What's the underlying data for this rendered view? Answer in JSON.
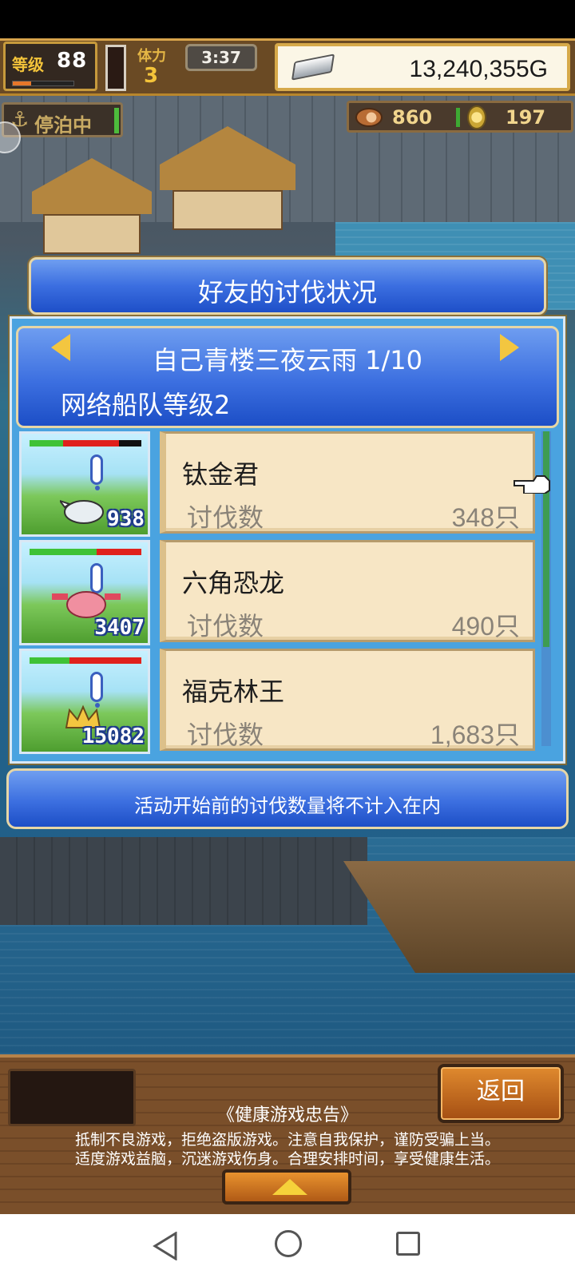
{
  "hud": {
    "level_label": "等级",
    "level_value": "88",
    "exp_fraction": 0.3,
    "stamina_label": "体力",
    "stamina_value": "3",
    "time": "3:37",
    "gold": "13,240,355G",
    "dock_status": "停泊中",
    "food": "860",
    "coins": "197"
  },
  "dialog": {
    "title": "好友的讨伐状况",
    "player_name": "自己青楼三夜云雨 1/10",
    "fleet_level": "网络船队等级2",
    "rows": [
      {
        "monster_kills_badge": "938",
        "friend": "钛金君",
        "kill_label": "讨伐数",
        "kill_count": "348只",
        "hp_green": 0.3,
        "hp_red": 0.5
      },
      {
        "monster_kills_badge": "3407",
        "friend": "六角恐龙",
        "kill_label": "讨伐数",
        "kill_count": "490只",
        "hp_green": 0.6,
        "hp_red": 0.4
      },
      {
        "monster_kills_badge": "15082",
        "friend": "福克林王",
        "kill_label": "讨伐数",
        "kill_count": "1,683只",
        "hp_green": 0.36,
        "hp_red": 0.64
      }
    ],
    "notice": "活动开始前的讨伐数量将不计入在内"
  },
  "bottom": {
    "back_label": "返回",
    "health_title": "《健康游戏忠告》",
    "health_line1": "抵制不良游戏，拒绝盗版游戏。注意自我保护，谨防受骗上当。",
    "health_line2": "适度游戏益脑，沉迷游戏伤身。合理安排时间，享受健康生活。"
  },
  "icons": {
    "anchor": "anchor-icon",
    "silver": "silver-ingot-icon",
    "food": "meat-icon",
    "coin": "coin-icon",
    "pointer": "pointing-hand-icon"
  }
}
